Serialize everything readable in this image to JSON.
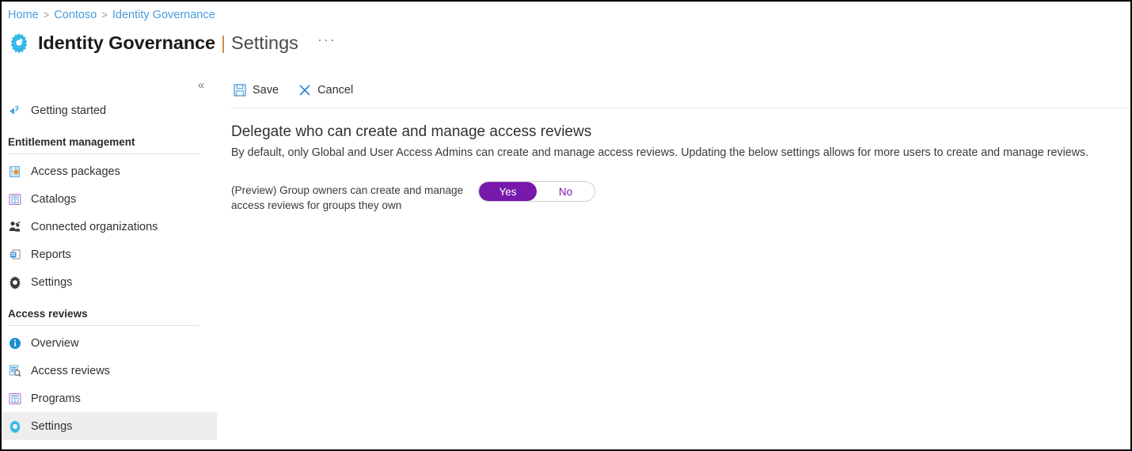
{
  "breadcrumb": {
    "items": [
      {
        "label": "Home"
      },
      {
        "label": "Contoso"
      },
      {
        "label": "Identity Governance"
      }
    ],
    "separator": ">"
  },
  "header": {
    "icon": "identity-governance-gear-icon",
    "title": "Identity Governance",
    "divider": "|",
    "subtitle": "Settings",
    "more_label": "···"
  },
  "sidebar": {
    "collapse_label": "«",
    "top_items": [
      {
        "label": "Getting started",
        "icon": "getting-started-icon",
        "selected": false
      }
    ],
    "sections": [
      {
        "title": "Entitlement management",
        "items": [
          {
            "label": "Access packages",
            "icon": "access-packages-icon",
            "selected": false
          },
          {
            "label": "Catalogs",
            "icon": "catalogs-book-icon",
            "selected": false
          },
          {
            "label": "Connected organizations",
            "icon": "connected-organizations-people-icon",
            "selected": false
          },
          {
            "label": "Reports",
            "icon": "reports-document-icon",
            "selected": false
          },
          {
            "label": "Settings",
            "icon": "settings-gear-icon",
            "selected": false
          }
        ]
      },
      {
        "title": "Access reviews",
        "items": [
          {
            "label": "Overview",
            "icon": "overview-info-icon",
            "selected": false
          },
          {
            "label": "Access reviews",
            "icon": "access-reviews-search-doc-icon",
            "selected": false
          },
          {
            "label": "Programs",
            "icon": "programs-book-icon",
            "selected": false
          },
          {
            "label": "Settings",
            "icon": "settings-gear-cyan-icon",
            "selected": true
          }
        ]
      }
    ]
  },
  "toolbar": {
    "save_label": "Save",
    "save_icon": "save-floppy-icon",
    "cancel_label": "Cancel",
    "cancel_icon": "cancel-x-icon"
  },
  "main": {
    "heading": "Delegate who can create and manage access reviews",
    "description": "By default, only Global and User Access Admins can create and manage access reviews. Updating the below settings allows for more users to create and manage reviews.",
    "setting": {
      "label": "(Preview) Group owners can create and manage access reviews for groups they own",
      "toggle": {
        "on_label": "Yes",
        "off_label": "No",
        "value": "Yes"
      }
    }
  },
  "colors": {
    "accent_blue": "#4a9bdc",
    "toggle_purple": "#7719aa",
    "gear_cyan": "#32b8e8",
    "title_divider": "#c8863c",
    "selected_row": "#eeeeee"
  }
}
